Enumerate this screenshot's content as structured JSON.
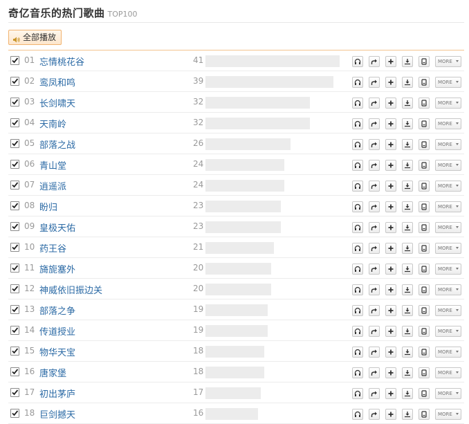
{
  "header": {
    "title": "奇亿音乐的热门歌曲",
    "subtitle": "TOP100"
  },
  "play_all_label": "全部播放",
  "icons": [
    "headphones-icon",
    "share-arrow-icon",
    "plus-icon",
    "download-icon",
    "phone-icon"
  ],
  "more_label": "MORE",
  "songs": [
    {
      "rank": "01",
      "title": "忘情桃花谷",
      "score": 41
    },
    {
      "rank": "02",
      "title": "鸾凤和鸣",
      "score": 39
    },
    {
      "rank": "03",
      "title": "长剑啸天",
      "score": 32
    },
    {
      "rank": "04",
      "title": "天南岭",
      "score": 32
    },
    {
      "rank": "05",
      "title": "部落之战",
      "score": 26
    },
    {
      "rank": "06",
      "title": "青山堂",
      "score": 24
    },
    {
      "rank": "07",
      "title": "逍遥派",
      "score": 24
    },
    {
      "rank": "08",
      "title": "盼归",
      "score": 23
    },
    {
      "rank": "09",
      "title": "皇极天佑",
      "score": 23
    },
    {
      "rank": "10",
      "title": "药王谷",
      "score": 21
    },
    {
      "rank": "11",
      "title": "旖旎塞外",
      "score": 20
    },
    {
      "rank": "12",
      "title": "神威依旧振边关",
      "score": 20
    },
    {
      "rank": "13",
      "title": "部落之争",
      "score": 19
    },
    {
      "rank": "14",
      "title": "传道授业",
      "score": 19
    },
    {
      "rank": "15",
      "title": "物华天宝",
      "score": 18
    },
    {
      "rank": "16",
      "title": "唐家堡",
      "score": 18
    },
    {
      "rank": "17",
      "title": "初出茅庐",
      "score": 17
    },
    {
      "rank": "18",
      "title": "巨剑撼天",
      "score": 16
    }
  ]
}
